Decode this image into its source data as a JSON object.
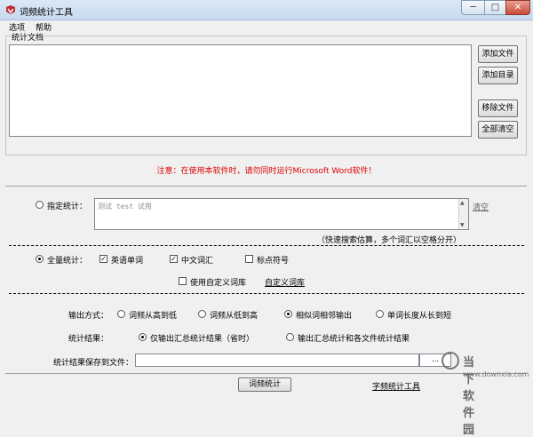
{
  "window": {
    "title": "词频统计工具",
    "caption_buttons": {
      "minimize": "─",
      "maximize": "□",
      "close": "✕"
    }
  },
  "menubar": {
    "items": [
      "选项",
      "帮助"
    ]
  },
  "file_group": {
    "legend": "统计文档",
    "buttons": {
      "add_file": "添加文件",
      "add_dir": "添加目录",
      "remove_file": "移除文件",
      "clear_all": "全部清空"
    }
  },
  "notice": "注意：在使用本软件时，请勿同时运行Microsoft Word软件！",
  "specify": {
    "label": "指定统计：",
    "value": "测试 test 试用",
    "clear_link": "清空",
    "hint": "（快速搜索估算，多个词汇以空格分开）",
    "selected": false
  },
  "full": {
    "label": "全量统计：",
    "selected": true,
    "options": [
      {
        "label": "英语单词",
        "checked": true
      },
      {
        "label": "中文词汇",
        "checked": true
      },
      {
        "label": "标点符号",
        "checked": false
      }
    ],
    "custom_dict": {
      "label": "使用自定义词库",
      "checked": false
    },
    "custom_dict_link": "自定义词库"
  },
  "output": {
    "mode_label": "输出方式：",
    "modes": [
      {
        "label": "词频从高到低",
        "selected": false
      },
      {
        "label": "词频从低到高",
        "selected": false
      },
      {
        "label": "相似词相邻输出",
        "selected": true
      },
      {
        "label": "单词长度从长到短",
        "selected": false
      }
    ],
    "result_label": "统计结果：",
    "results": [
      {
        "label": "仅输出汇总统计结果（省时）",
        "selected": true
      },
      {
        "label": "输出汇总统计和各文件统计结果",
        "selected": false
      }
    ],
    "save_label": "统计结果保存到文件：",
    "save_value": "",
    "browse": "..."
  },
  "footer": {
    "count_button": "词频统计",
    "link": "字频统计工具"
  },
  "watermark": {
    "text": "当下软件园",
    "url": "www.downxia.com"
  },
  "colors": {
    "notice": "#e00000",
    "titlebar": "#c6daf0",
    "close_button": "#c94a35"
  }
}
